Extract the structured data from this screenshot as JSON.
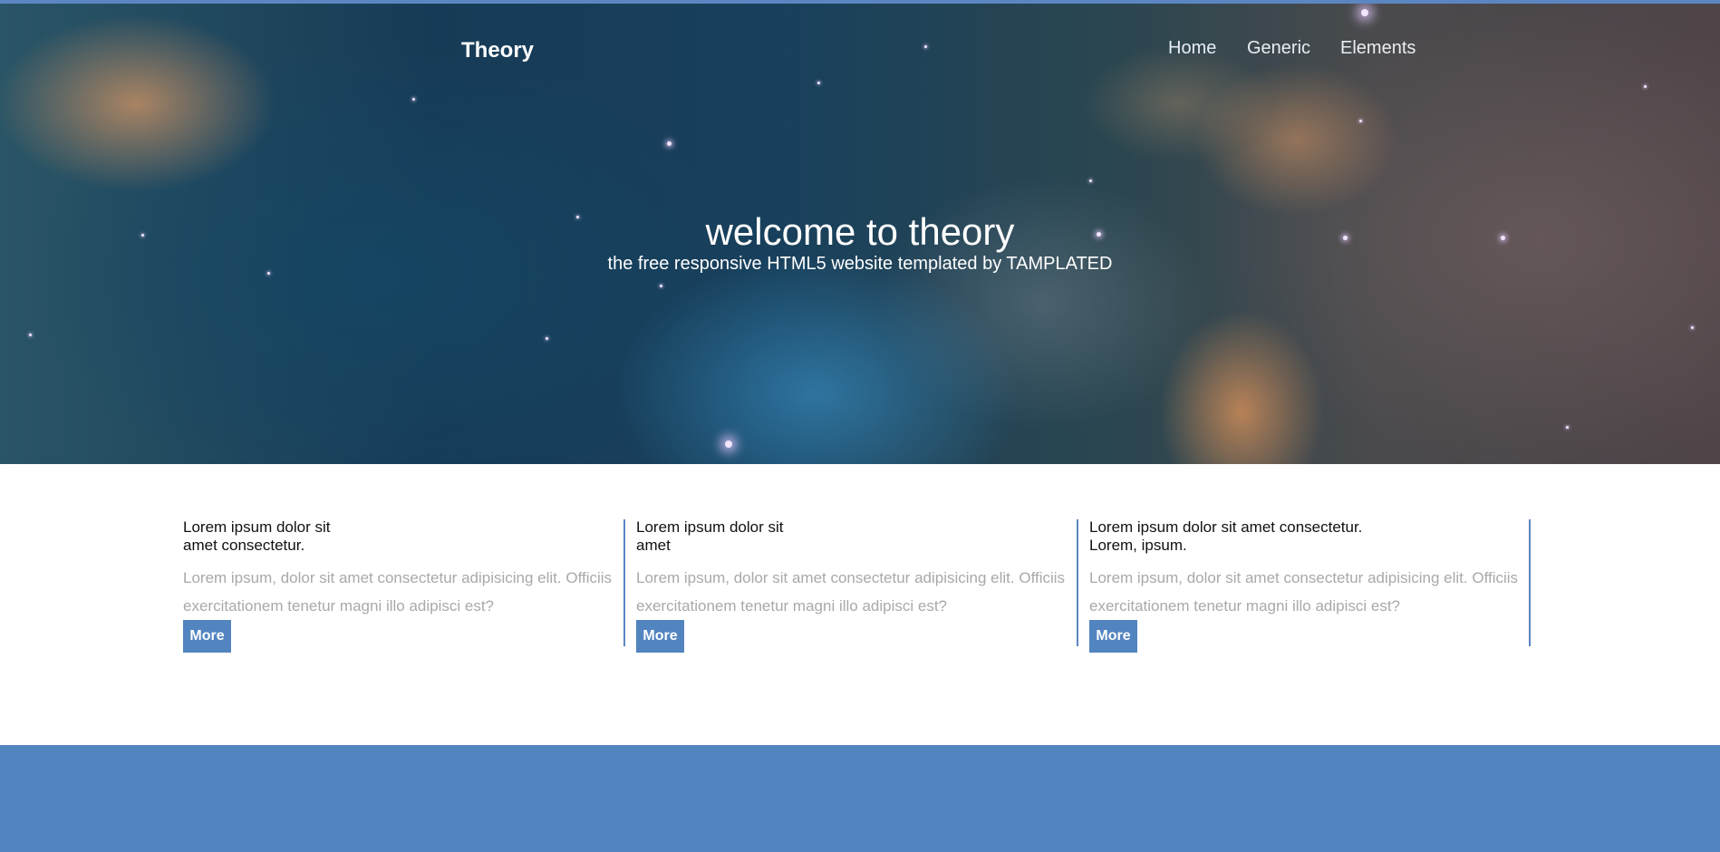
{
  "header": {
    "brand": "Theory",
    "nav": [
      {
        "label": "Home"
      },
      {
        "label": "Generic"
      },
      {
        "label": "Elements"
      }
    ]
  },
  "hero": {
    "title": "welcome to theory",
    "subtitle": "the free responsive HTML5 website templated by TAMPLATED"
  },
  "features": [
    {
      "title": "Lorem ipsum dolor sit\namet consectetur.",
      "text": "Lorem ipsum, dolor sit amet consectetur adipisicing elit. Officiis exercitationem tenetur magni illo adipisci est?",
      "button": "More"
    },
    {
      "title": "Lorem ipsum dolor sit\namet",
      "text": "Lorem ipsum, dolor sit amet consectetur adipisicing elit. Officiis exercitationem tenetur magni illo adipisci est?",
      "button": "More"
    },
    {
      "title": "Lorem ipsum dolor sit amet consectetur.\nLorem, ipsum.",
      "text": "Lorem ipsum, dolor sit amet consectetur adipisicing elit. Officiis exercitationem tenetur magni illo adipisci est?",
      "button": "More"
    }
  ],
  "colors": {
    "accent": "#5284c0",
    "muted_text": "#a9a9a9"
  }
}
